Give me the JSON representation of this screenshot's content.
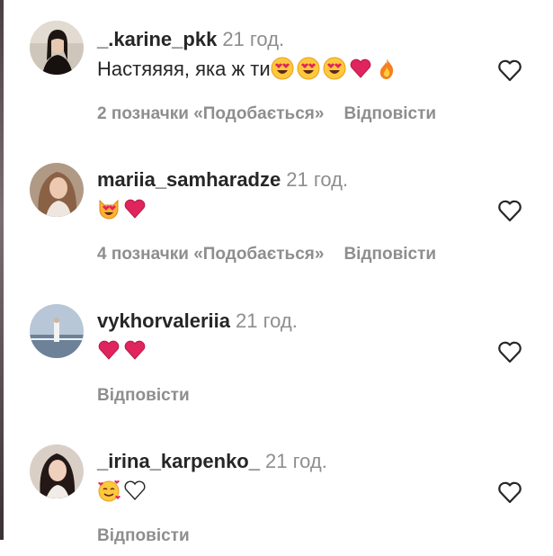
{
  "comments": [
    {
      "username": "_.karine_pkk",
      "time": "21 год.",
      "text": "Настяяяя, яка ж ти",
      "emojis": [
        "heart-eyes-face",
        "heart-eyes-face",
        "heart-eyes-face",
        "red-heart",
        "fire"
      ],
      "likes": "2 позначки «Подобається»",
      "reply": "Відповісти"
    },
    {
      "username": "mariia_samharadze",
      "time": "21 год.",
      "text": "",
      "emojis": [
        "heart-eyes-cat",
        "red-heart"
      ],
      "likes": "4 позначки «Подобається»",
      "reply": "Відповісти"
    },
    {
      "username": "vykhorvaleriia",
      "time": "21 год.",
      "text": "",
      "emojis": [
        "red-heart",
        "red-heart"
      ],
      "likes": "",
      "reply": "Відповісти"
    },
    {
      "username": "_irina_karpenko_",
      "time": "21 год.",
      "text": "",
      "emojis": [
        "smiling-face-with-hearts",
        "white-heart"
      ],
      "likes": "",
      "reply": "Відповісти"
    }
  ],
  "icons": {
    "like": "heart-outline-icon"
  },
  "colors": {
    "text": "#262626",
    "secondary": "#8e8e8e",
    "heart": "#e0245e"
  }
}
